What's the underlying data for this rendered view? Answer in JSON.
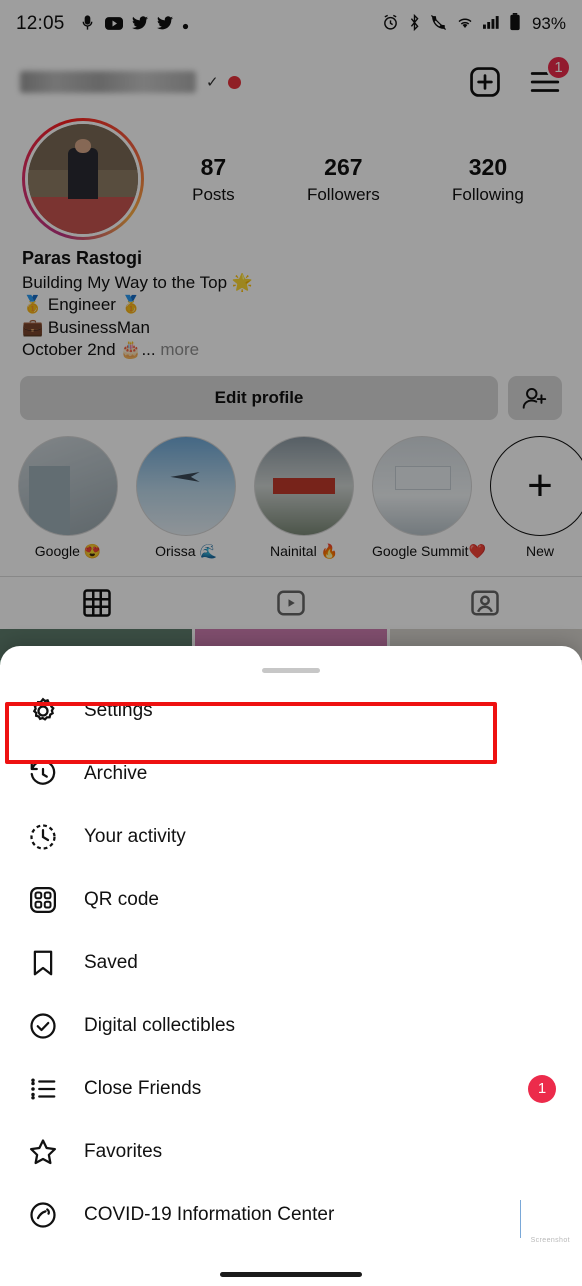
{
  "status_bar": {
    "time": "12:05",
    "left_icons": [
      "podcast-icon",
      "youtube-icon",
      "twitter-icon",
      "twitter-icon",
      "dot-icon"
    ],
    "right_icons": [
      "alarm-icon",
      "bluetooth-icon",
      "call-mute-icon",
      "wifi-icon",
      "signal-icon",
      "battery-icon"
    ],
    "battery_percent": "93%"
  },
  "profile": {
    "username_masked": "",
    "verified_tick": "✓",
    "header_icons": {
      "add": "plus-box-icon",
      "menu": "hamburger-icon"
    },
    "menu_badge": "1",
    "stats": [
      {
        "num": "87",
        "label": "Posts"
      },
      {
        "num": "267",
        "label": "Followers"
      },
      {
        "num": "320",
        "label": "Following"
      }
    ],
    "display_name": "Paras Rastogi",
    "bio_lines": [
      "Building My Way to the Top 🌟",
      "🥇 Engineer 🥇",
      "💼 BusinessMan"
    ],
    "bio_last_line": "October 2nd 🎂...",
    "more_label": " more",
    "edit_profile_label": "Edit profile",
    "add_person_icon": "add-person-icon",
    "highlights": [
      {
        "label": "Google 😍"
      },
      {
        "label": "Orissa 🌊"
      },
      {
        "label": "Nainital 🔥"
      },
      {
        "label": "Google Summit❤️"
      },
      {
        "label": "New",
        "plus": "+"
      }
    ],
    "tabs": [
      {
        "icon": "grid-icon",
        "active": true
      },
      {
        "icon": "reels-icon",
        "active": false
      },
      {
        "icon": "tagged-icon",
        "active": false
      }
    ]
  },
  "sheet": {
    "grabber": "drag-handle",
    "items": [
      {
        "icon": "settings-gear-icon",
        "label": "Settings",
        "badge": "",
        "highlighted": true
      },
      {
        "icon": "archive-clock-icon",
        "label": "Archive",
        "badge": ""
      },
      {
        "icon": "activity-clock-icon",
        "label": "Your activity",
        "badge": ""
      },
      {
        "icon": "qr-code-icon",
        "label": "QR code",
        "badge": ""
      },
      {
        "icon": "bookmark-icon",
        "label": "Saved",
        "badge": ""
      },
      {
        "icon": "digital-collectibles-icon",
        "label": "Digital collectibles",
        "badge": ""
      },
      {
        "icon": "close-friends-icon",
        "label": "Close Friends",
        "badge": "1"
      },
      {
        "icon": "star-icon",
        "label": "Favorites",
        "badge": ""
      },
      {
        "icon": "covid-info-icon",
        "label": "COVID-19 Information Center",
        "badge": ""
      }
    ]
  },
  "colors": {
    "accent_red": "#ec2b4b",
    "highlight_box": "#ee1111",
    "button_grey": "#d8d8d8",
    "text_primary": "#111111",
    "text_secondary": "#8e8e8e"
  }
}
